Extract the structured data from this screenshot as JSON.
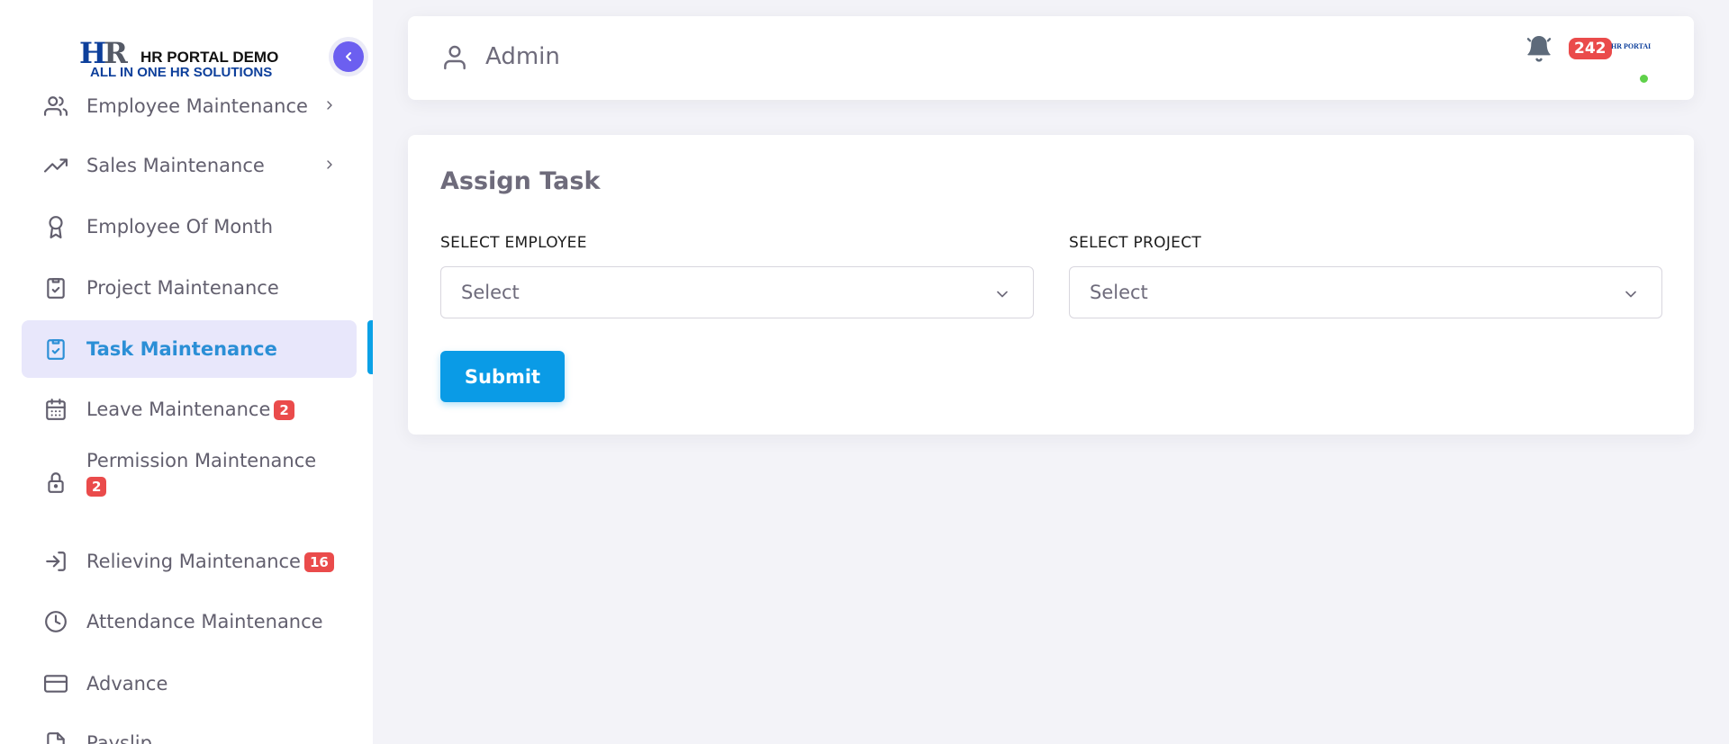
{
  "brand": {
    "mark_h": "H",
    "mark_r": "R",
    "name": "HR PORTAL DEMO",
    "tagline": "ALL IN ONE HR SOLUTIONS"
  },
  "sidebar": {
    "items": [
      {
        "label": "Employee Maintenance",
        "icon": "users-icon",
        "has_chevron": true
      },
      {
        "label": "Sales Maintenance",
        "icon": "trending-up-icon",
        "has_chevron": true
      },
      {
        "label": "Employee Of Month",
        "icon": "award-icon"
      },
      {
        "label": "Project Maintenance",
        "icon": "clipboard-check-icon"
      },
      {
        "label": "Task Maintenance",
        "icon": "clipboard-check-icon",
        "active": true
      },
      {
        "label": "Leave Maintenance",
        "icon": "calendar-icon",
        "badge": "2"
      },
      {
        "label": "Permission Maintenance",
        "icon": "lock-icon",
        "badge": "2"
      },
      {
        "label": "Relieving Maintenance",
        "icon": "log-in-icon",
        "badge": "16"
      },
      {
        "label": "Attendance Maintenance",
        "icon": "clock-icon"
      },
      {
        "label": "Advance",
        "icon": "credit-card-icon"
      },
      {
        "label": "Payslip",
        "icon": "file-icon"
      }
    ]
  },
  "navbar": {
    "user_label": "Admin",
    "notification_count": "242",
    "avatar_text": "HR PORTAL DEMO"
  },
  "form": {
    "title": "Assign Task",
    "employee_label": "SELECT EMPLOYEE",
    "employee_value": "Select",
    "project_label": "SELECT PROJECT",
    "project_value": "Select",
    "submit_label": "Submit"
  },
  "colors": {
    "accent": "#0a9be6",
    "active_text": "#2b8fd6",
    "active_bg": "#e8e7fb",
    "badge": "#ea4b4b",
    "collapse": "#6c5ff0",
    "online": "#5fd14a"
  }
}
